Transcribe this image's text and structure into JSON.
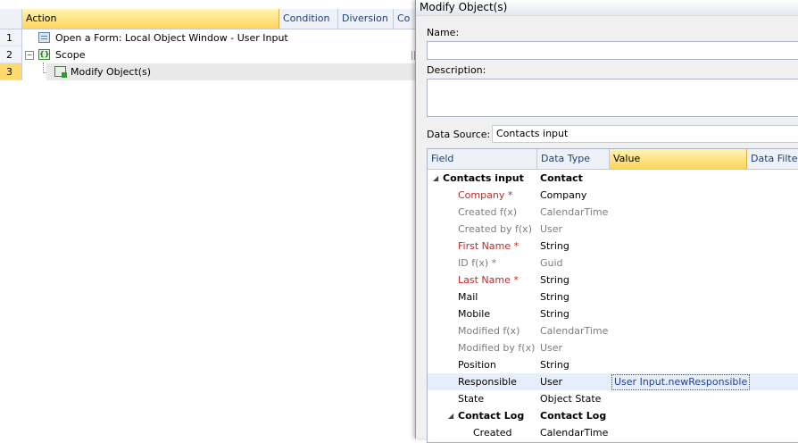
{
  "left": {
    "headers": {
      "corner": "",
      "action": "Action",
      "condition": "Condition",
      "diversion": "Diversion",
      "co": "Co"
    },
    "rows": [
      {
        "num": "1",
        "label": "Open a Form: Local Object Window - User Input"
      },
      {
        "num": "2",
        "label": "Scope",
        "expander": "−"
      },
      {
        "num": "3",
        "label": "Modify Object(s)"
      }
    ]
  },
  "dialog": {
    "title": "Modify Object(s)",
    "name_label": "Name:",
    "name_value": "",
    "description_label": "Description:",
    "description_value": "",
    "datasource_label": "Data Source:",
    "datasource_value": "Contacts input"
  },
  "grid": {
    "headers": {
      "field": "Field",
      "data_type": "Data Type",
      "value": "Value",
      "data_filter": "Data Filter"
    },
    "rows": [
      {
        "field": "Contacts input",
        "type": "Contact",
        "value": ""
      },
      {
        "field": "Company *",
        "type": "Company",
        "value": ""
      },
      {
        "field": "Created f(x)",
        "type": "CalendarTime",
        "value": ""
      },
      {
        "field": "Created by f(x)",
        "type": "User",
        "value": ""
      },
      {
        "field": "First Name *",
        "type": "String",
        "value": ""
      },
      {
        "field": "ID f(x) *",
        "type": "Guid",
        "value": ""
      },
      {
        "field": "Last Name *",
        "type": "String",
        "value": ""
      },
      {
        "field": "Mail",
        "type": "String",
        "value": ""
      },
      {
        "field": "Mobile",
        "type": "String",
        "value": ""
      },
      {
        "field": "Modified f(x)",
        "type": "CalendarTime",
        "value": ""
      },
      {
        "field": "Modified by f(x)",
        "type": "User",
        "value": ""
      },
      {
        "field": "Position",
        "type": "String",
        "value": ""
      },
      {
        "field": "Responsible",
        "type": "User",
        "value": "User Input.newResponsible"
      },
      {
        "field": "State",
        "type": "Object State",
        "value": ""
      },
      {
        "field": "Contact Log",
        "type": "Contact Log",
        "value": ""
      },
      {
        "field": "Created",
        "type": "CalendarTime",
        "value": ""
      }
    ]
  },
  "colors": {
    "header_accent": "#ffd45c",
    "required": "#c0282d",
    "disabled": "#7d7d7d",
    "value_link": "#1f3fa3"
  }
}
